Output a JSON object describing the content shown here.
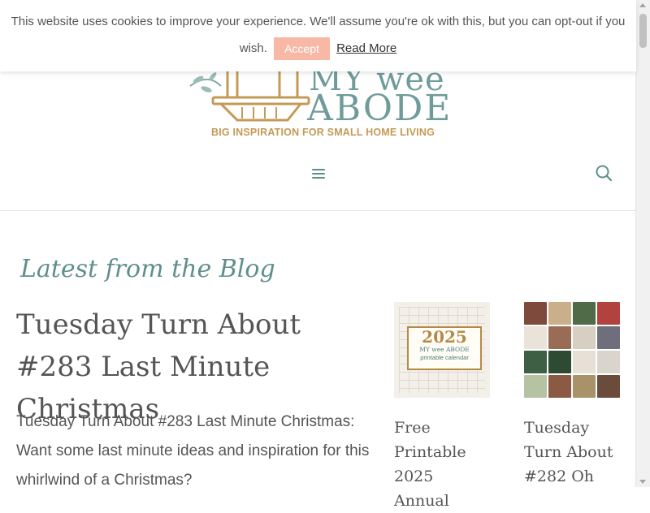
{
  "cookie": {
    "text_line1": "This website uses cookies to improve your experience. We'll assume you're ok with this, but you can opt-out if you",
    "text_line2": "wish.",
    "accept_label": "Accept",
    "read_more_label": "Read More"
  },
  "logo": {
    "word_top": "MY wee",
    "word_main": "ABODE",
    "tagline": "BIG INSPIRATION FOR SMALL HOME LIVING"
  },
  "nav": {
    "menu_icon": "hamburger-icon",
    "search_icon": "search-icon"
  },
  "main": {
    "section_title": "Latest from the Blog",
    "featured": {
      "title": "Tuesday Turn About #283 Last Minute Christmas",
      "excerpt": "Tuesday Turn About #283 Last Minute Christmas: Want some last minute ideas and inspiration for this whirlwind of a Christmas?"
    },
    "cards": [
      {
        "title": "Free Printable 2025 Annual",
        "thumb": {
          "year": "2025",
          "brand": "MY wee ABODE",
          "subtitle": "printable calendar"
        }
      },
      {
        "title": "Tuesday Turn About #282 Oh"
      }
    ]
  },
  "colors": {
    "accent": "#5f8f8d",
    "gold": "#c49a56",
    "accept_bg": "#f7b9a6"
  }
}
